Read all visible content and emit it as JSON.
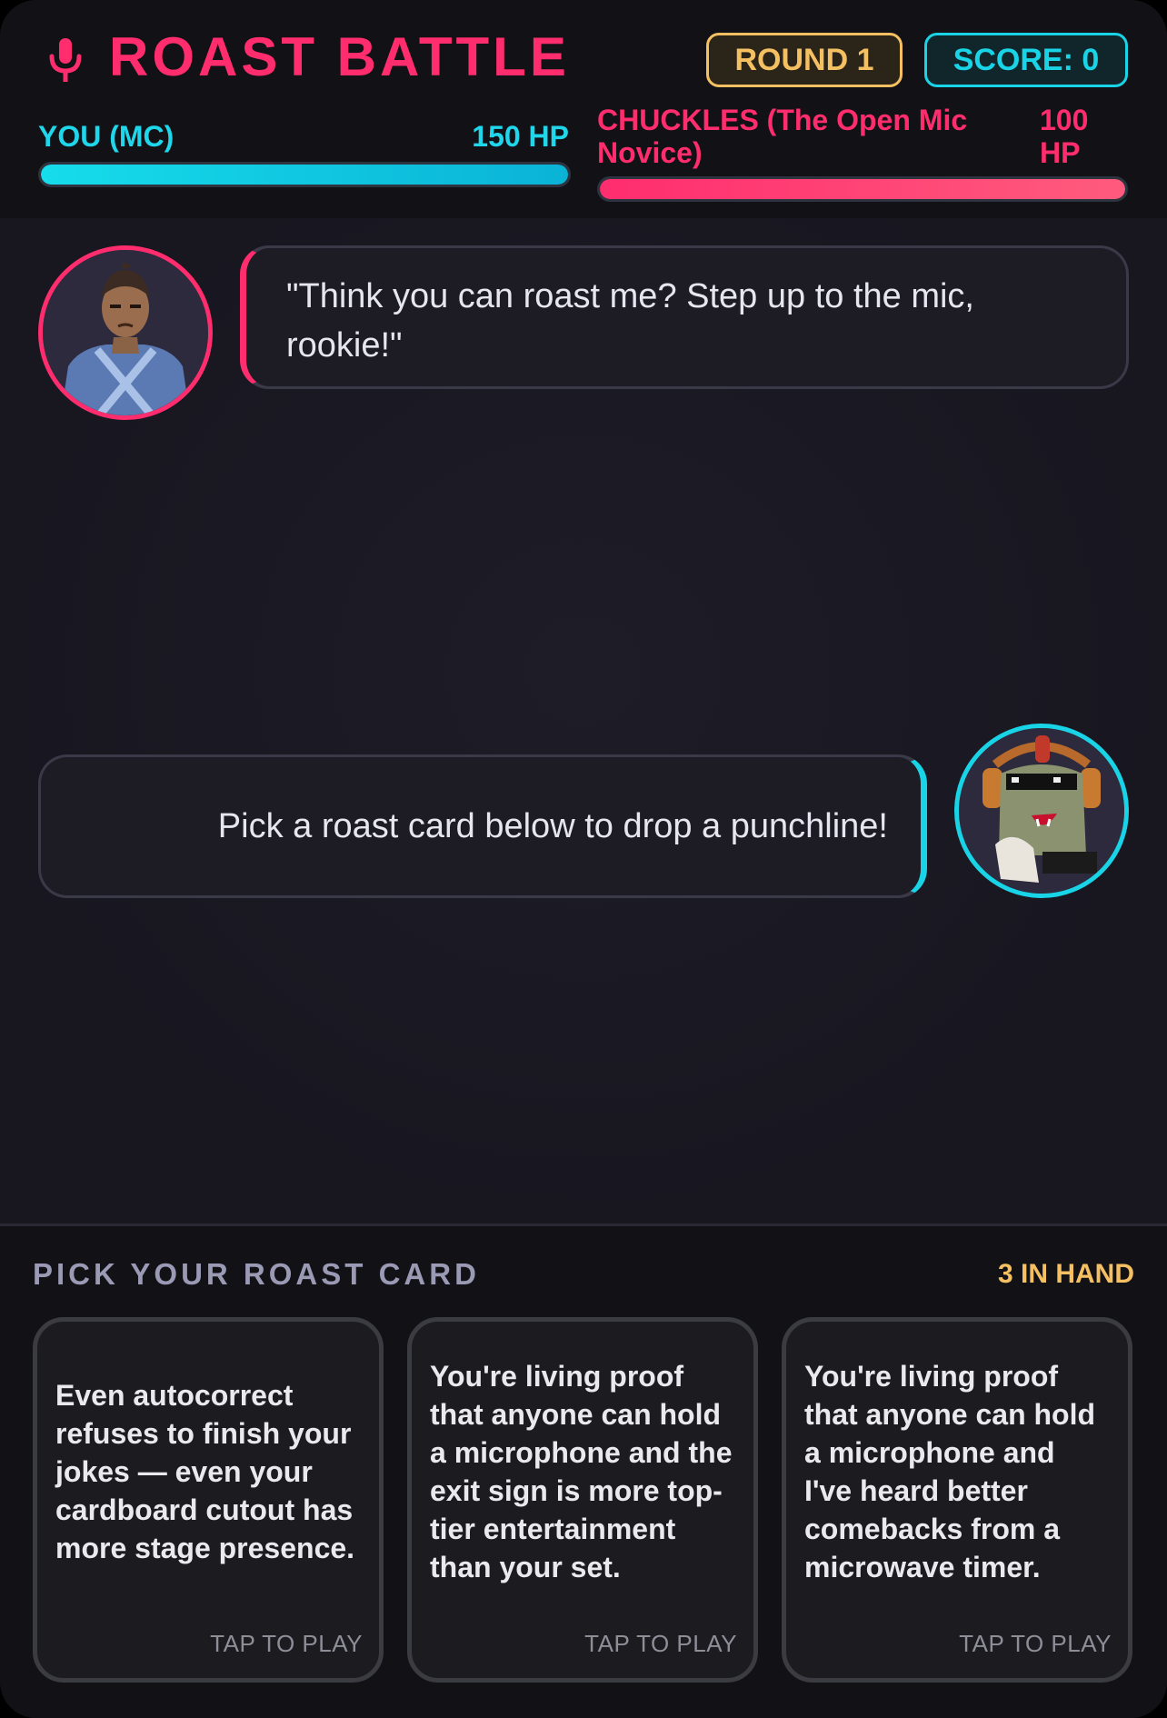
{
  "header": {
    "title": "ROAST BATTLE",
    "round_badge": "ROUND 1",
    "score_badge": "SCORE: 0",
    "title_icon": "microphone-icon"
  },
  "players": {
    "you": {
      "name": "YOU (MC)",
      "hp_label": "150 HP",
      "hp_fraction": 1.0,
      "color": "#1fd6ea"
    },
    "opponent": {
      "name": "CHUCKLES (The Open Mic Novice)",
      "hp_label": "100 HP",
      "hp_fraction": 1.0,
      "color": "#ff2d6e"
    }
  },
  "chat": {
    "host_message": "\"Think you can roast me? Step up to the mic, rookie!\"",
    "bot_message": "Pick a roast card below to drop a punchline!"
  },
  "tray": {
    "title": "PICK YOUR ROAST CARD",
    "count": "3 IN HAND",
    "cards": [
      {
        "text": "Even autocorrect refuses to finish your jokes — even your cardboard cutout has more stage presence.",
        "cta": "TAP TO PLAY"
      },
      {
        "text": "You're living proof that anyone can hold a microphone and the exit sign is more top-tier entertainment than your set.",
        "cta": "TAP TO PLAY"
      },
      {
        "text": "You're living proof that anyone can hold a microphone and I've heard better comebacks from a microwave timer.",
        "cta": "TAP TO PLAY"
      }
    ]
  },
  "colors": {
    "accent_pink": "#ff2d6e",
    "accent_cyan": "#19d3e6",
    "accent_gold": "#f5c062",
    "background": "#18161f"
  }
}
